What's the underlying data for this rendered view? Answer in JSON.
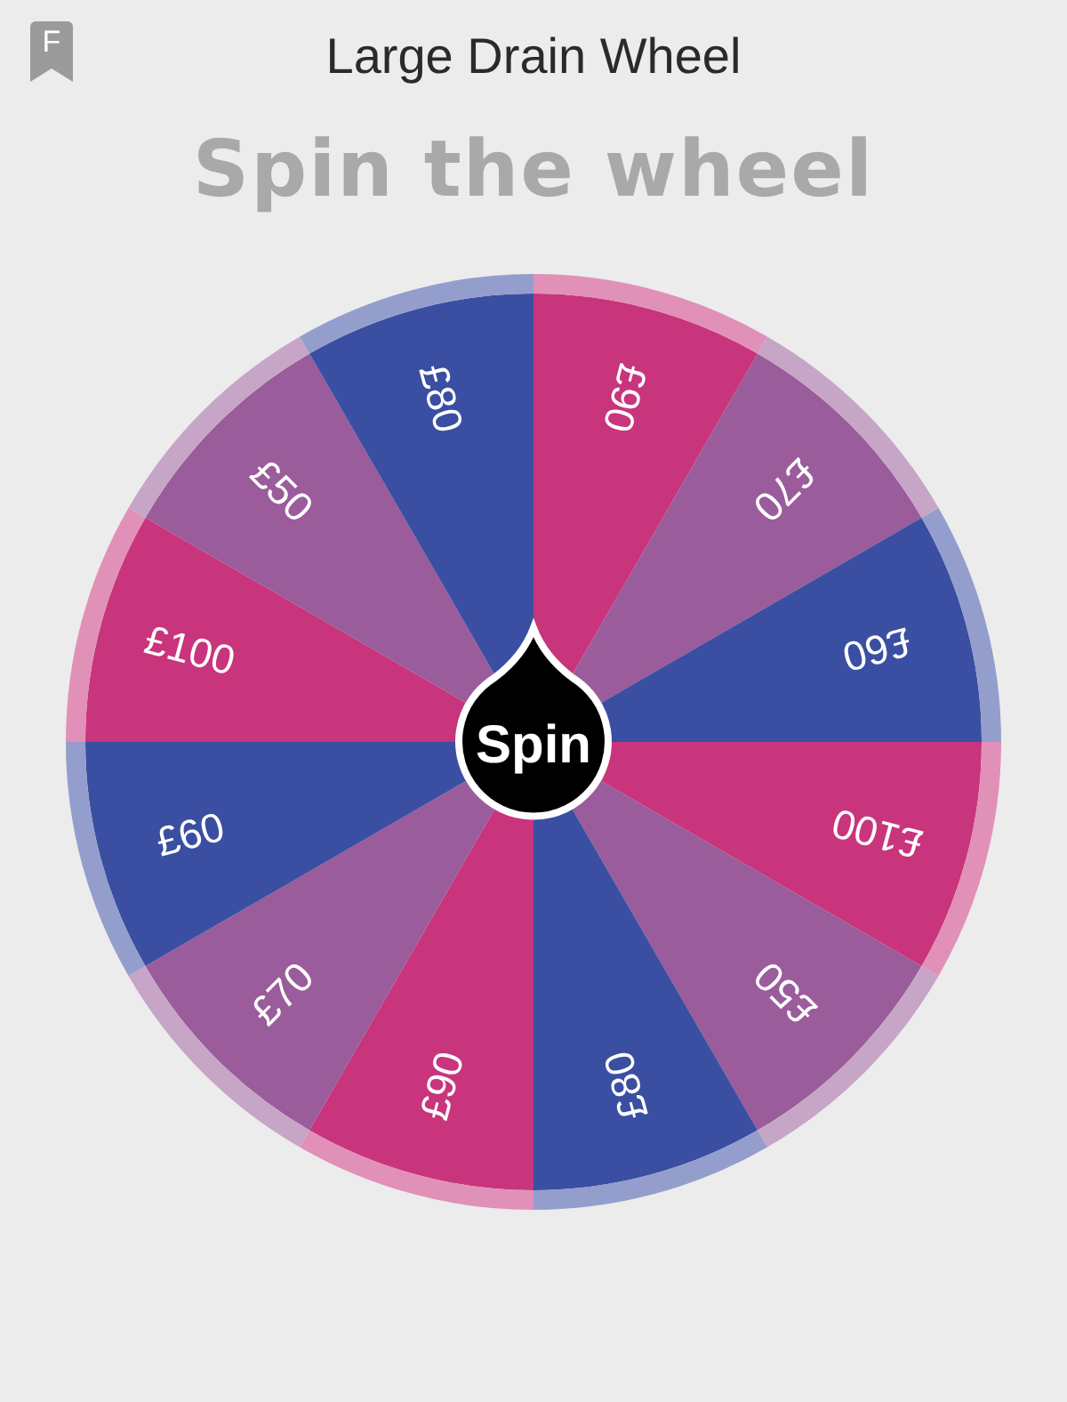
{
  "badge": "F",
  "title": "Large Drain Wheel",
  "heading": "Spin the wheel",
  "segments": [
    {
      "label": "£90",
      "color": "#c8357c"
    },
    {
      "label": "£70",
      "color": "#9a5c9a"
    },
    {
      "label": "£60",
      "color": "#3a4ea2"
    },
    {
      "label": "£100",
      "color": "#c8357c"
    },
    {
      "label": "£50",
      "color": "#9a5c9a"
    },
    {
      "label": "£80",
      "color": "#3a4ea2"
    },
    {
      "label": "£90",
      "color": "#c8357c"
    },
    {
      "label": "£70",
      "color": "#9a5c9a"
    },
    {
      "label": "£60",
      "color": "#3a4ea2"
    },
    {
      "label": "£100",
      "color": "#c8357c"
    },
    {
      "label": "£50",
      "color": "#9a5c9a"
    },
    {
      "label": "£80",
      "color": "#3a4ea2"
    }
  ],
  "spin_button": "Spin"
}
